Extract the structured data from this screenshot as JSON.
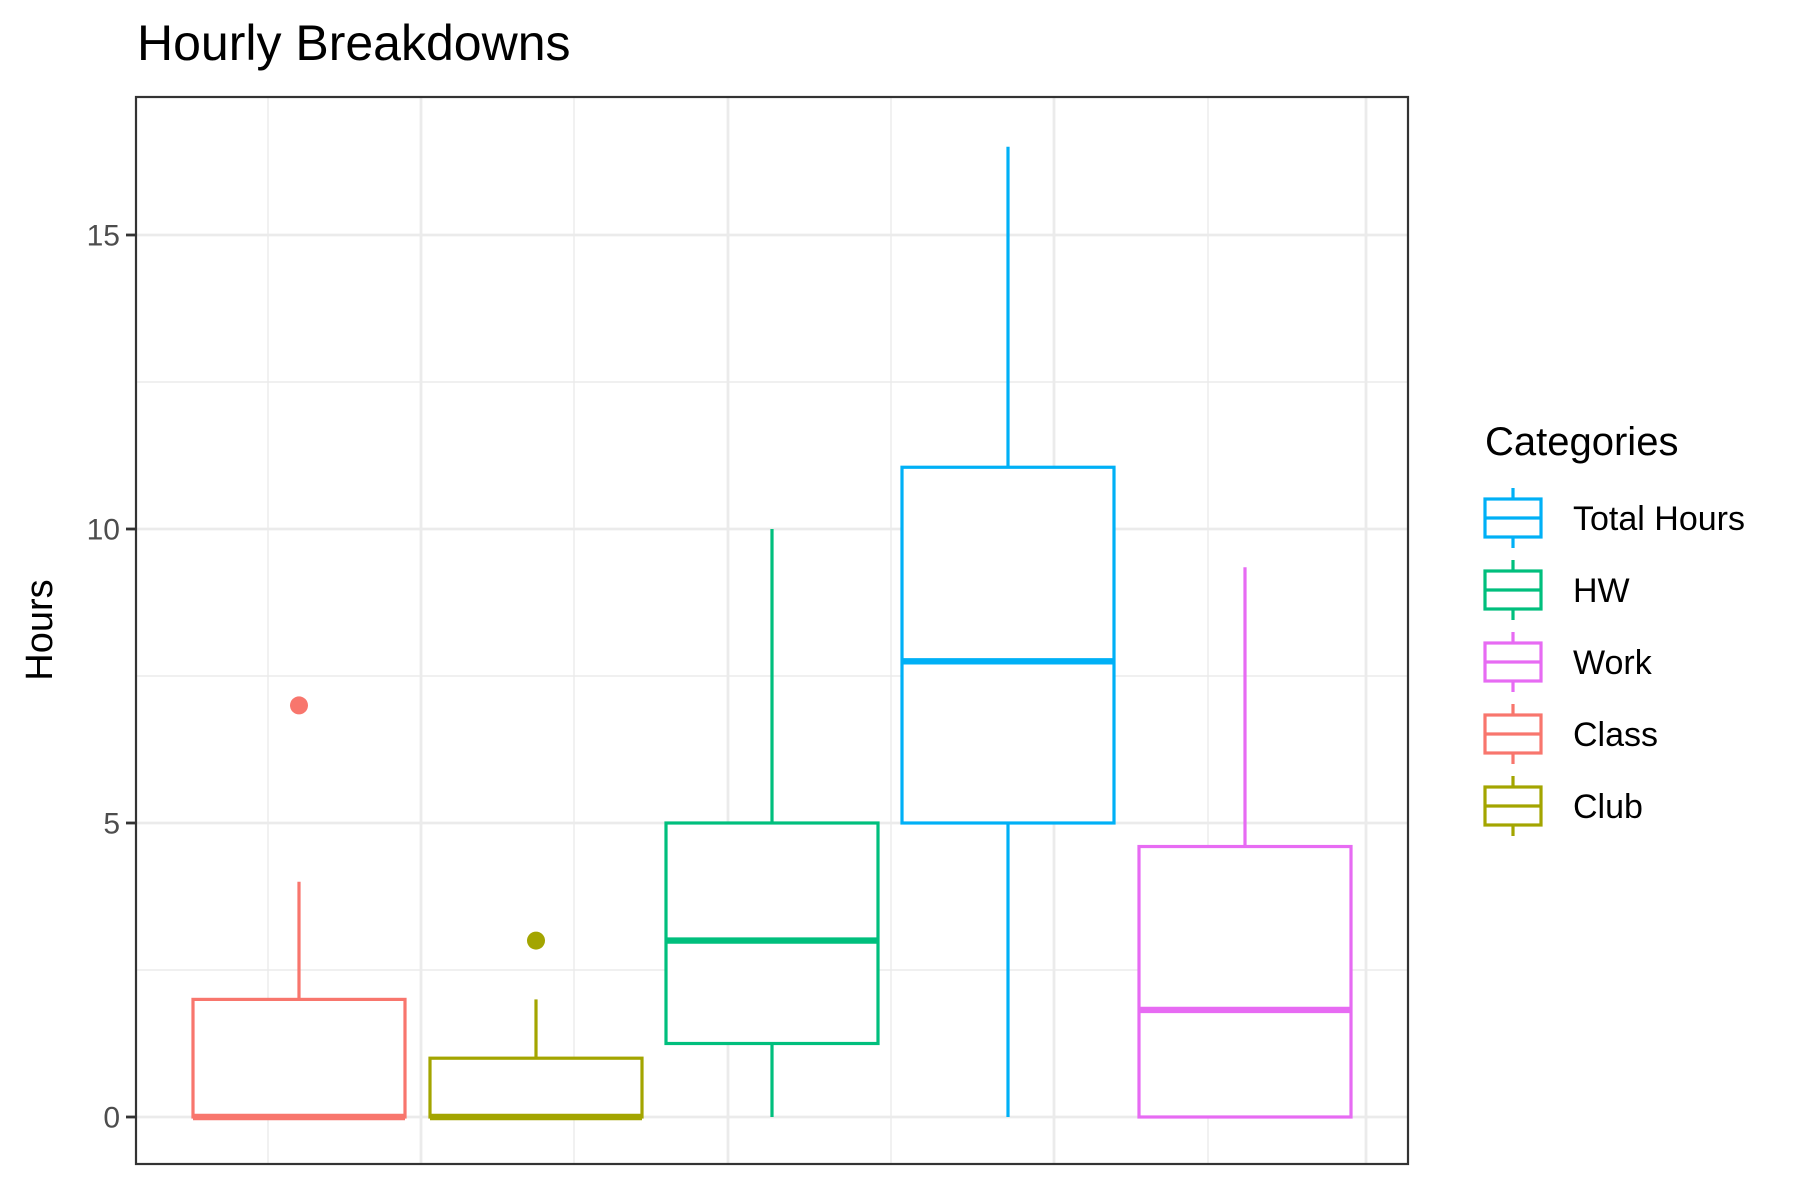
{
  "chart_data": {
    "type": "boxplot",
    "title": "Hourly Breakdowns",
    "xlabel": "",
    "ylabel": "Hours",
    "ylim": [
      -0.8,
      17.3
    ],
    "yticks": [
      0,
      5,
      10,
      15
    ],
    "ytick_labels": [
      "0",
      "5",
      "10",
      "15"
    ],
    "y_minor_gridlines": [
      2.5,
      7.5,
      12.5
    ],
    "x_tick_labels_shown": false,
    "grid": true,
    "legend": {
      "title": "Categories",
      "placement": "right",
      "entries": [
        {
          "label": "Total Hours",
          "color": "#00B0F6"
        },
        {
          "label": "HW",
          "color": "#00BF7D"
        },
        {
          "label": "Work",
          "color": "#E76BF3"
        },
        {
          "label": "Class",
          "color": "#F8766D"
        },
        {
          "label": "Club",
          "color": "#A3A500"
        }
      ]
    },
    "series": [
      {
        "name": "Class",
        "color": "#F8766D",
        "lower_whisker": 0,
        "q1": 0,
        "median": 0,
        "q3": 2,
        "upper_whisker": 4,
        "outliers": [
          7
        ]
      },
      {
        "name": "Club",
        "color": "#A3A500",
        "lower_whisker": 0,
        "q1": 0,
        "median": 0,
        "q3": 1,
        "upper_whisker": 2,
        "outliers": [
          3
        ]
      },
      {
        "name": "HW",
        "color": "#00BF7D",
        "lower_whisker": 0,
        "q1": 1.25,
        "median": 3,
        "q3": 5,
        "upper_whisker": 10,
        "outliers": []
      },
      {
        "name": "Total Hours",
        "color": "#00B0F6",
        "lower_whisker": 0,
        "q1": 5,
        "median": 7.75,
        "q3": 11.05,
        "upper_whisker": 16.5,
        "outliers": []
      },
      {
        "name": "Work",
        "color": "#E76BF3",
        "lower_whisker": 0,
        "q1": 0,
        "median": 1.82,
        "q3": 4.6,
        "upper_whisker": 9.35,
        "outliers": []
      }
    ]
  }
}
